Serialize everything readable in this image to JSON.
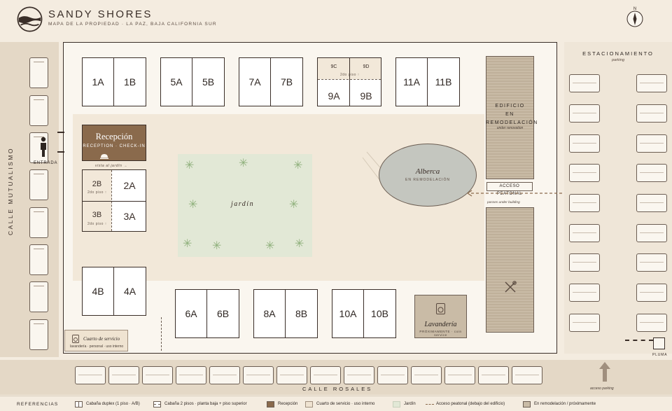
{
  "header": {
    "title": "SANDY SHORES",
    "subtitle": "MAPA DE LA PROPIEDAD · LA PAZ, BAJA CALIFORNIA SUR",
    "compass_label": "N"
  },
  "streets": {
    "left": "CALLE MUTUALISMO",
    "bottom": "CALLE ROSALES"
  },
  "entrance": {
    "label": "ENTRADA"
  },
  "cabins": {
    "c1": {
      "a": "1A",
      "b": "1B"
    },
    "c5": {
      "a": "5A",
      "b": "5B"
    },
    "c7": {
      "a": "7A",
      "b": "7B"
    },
    "c9": {
      "upper_a": "9C",
      "upper_b": "9D",
      "upper_note": "2do piso ↑",
      "a": "9A",
      "b": "9B"
    },
    "c11": {
      "a": "11A",
      "b": "11B"
    },
    "c2": {
      "upper": "2B",
      "upper_note": "2do piso ↑",
      "lower": "2A"
    },
    "c3": {
      "upper": "3B",
      "upper_note": "2do piso ↑",
      "lower": "3A"
    },
    "c4": {
      "a": "4B",
      "b": "4A"
    },
    "c6": {
      "a": "6A",
      "b": "6B"
    },
    "c8": {
      "a": "8A",
      "b": "8B"
    },
    "c10": {
      "a": "10A",
      "b": "10B"
    }
  },
  "reception": {
    "title": "Recepción",
    "subtitle": "RECEPTION · CHECK-IN",
    "view_note": "vista al jardín →"
  },
  "garden": {
    "label": "jardín"
  },
  "pool": {
    "title": "Alberca",
    "subtitle": "EN REMODELACIÓN"
  },
  "renovation": {
    "title_lines": [
      "EDIFICIO",
      "EN",
      "REMODELACIÓN"
    ],
    "subtitle": "under renovation"
  },
  "access": {
    "label": "ACCESO PEATONAL",
    "note": "passes under building"
  },
  "laundry": {
    "title": "Lavandería",
    "subtitle": "PRÓXIMAMENTE · coin service"
  },
  "service_room": {
    "title": "Cuarto de servicio",
    "subtitle": "lavandería · personal · uso interno"
  },
  "parking": {
    "title": "ESTACIONAMIENTO",
    "subtitle": "parking",
    "gate": "PLUMA",
    "access_note": "acceso parking"
  },
  "legend": {
    "title": "REFERENCIAS",
    "items": [
      "Cabaña duplex (1 piso · A/B)",
      "Cabaña 2 pisos · planta baja + piso superior",
      "Recepción",
      "Cuarto de servicio · uso interno",
      "Jardín",
      "Acceso peatonal (debajo del edificio)",
      "En remodelación / próximamente"
    ]
  },
  "colors": {
    "background": "#f4ece0",
    "reception": "#8a6a4c",
    "garden": "#e2e8d6",
    "pool": "#c4c6bf",
    "renovation": "#c9bba6",
    "outline": "#3a2e28"
  }
}
